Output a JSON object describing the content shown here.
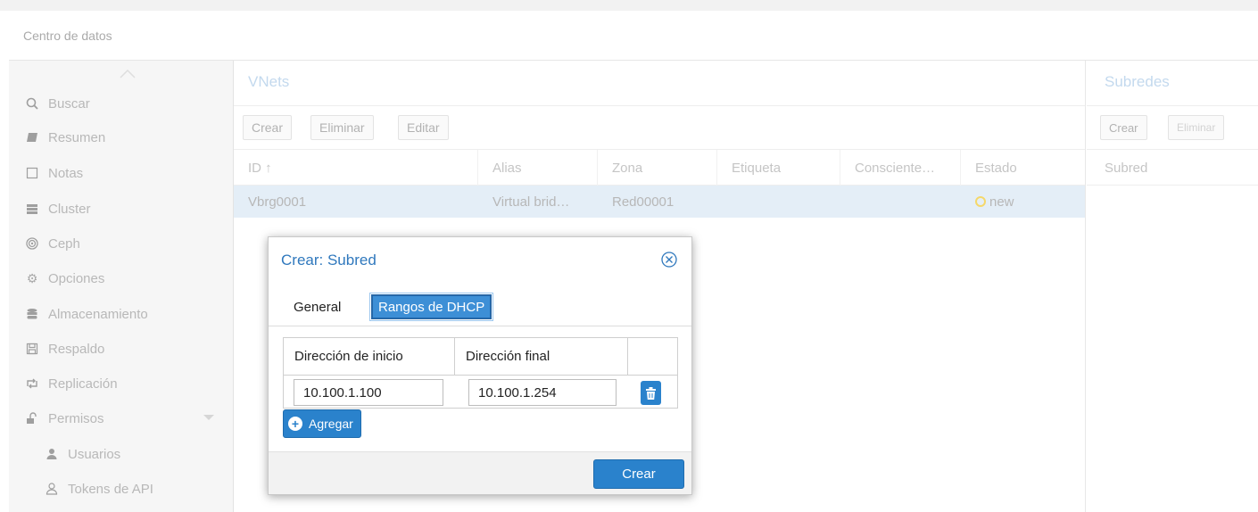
{
  "header": {
    "title": "Centro de datos"
  },
  "sidebar": {
    "items": [
      {
        "label": "Buscar",
        "icon": "search-icon"
      },
      {
        "label": "Resumen",
        "icon": "book-icon"
      },
      {
        "label": "Notas",
        "icon": "notes-icon"
      },
      {
        "label": "Cluster",
        "icon": "server-icon"
      },
      {
        "label": "Ceph",
        "icon": "ceph-icon"
      },
      {
        "label": "Opciones",
        "icon": "gear-icon"
      },
      {
        "label": "Almacenamiento",
        "icon": "database-icon"
      },
      {
        "label": "Respaldo",
        "icon": "floppy-icon"
      },
      {
        "label": "Replicación",
        "icon": "retweet-icon"
      },
      {
        "label": "Permisos",
        "icon": "unlock-icon"
      },
      {
        "label": "Usuarios",
        "icon": "user-icon"
      },
      {
        "label": "Tokens de API",
        "icon": "user-outline-icon"
      }
    ]
  },
  "vnets": {
    "title": "VNets",
    "toolbar": {
      "create": "Crear",
      "delete": "Eliminar",
      "edit": "Editar"
    },
    "columns": [
      "ID ↑",
      "Alias",
      "Zona",
      "Etiqueta",
      "Consciente…",
      "Estado"
    ],
    "rows": [
      {
        "id": "Vbrg0001",
        "alias": "Virtual brid…",
        "zone": "Red00001",
        "tag": "",
        "aware": "",
        "status": "new"
      }
    ]
  },
  "subnets": {
    "title": "Subredes",
    "toolbar": {
      "create": "Crear",
      "delete": "Eliminar"
    },
    "column": "Subred"
  },
  "dialog": {
    "title": "Crear: Subred",
    "tabs": [
      "General",
      "Rangos de DHCP"
    ],
    "active_tab": "Rangos de DHCP",
    "table": {
      "col_start": "Dirección de inicio",
      "col_end": "Dirección final",
      "rows": [
        {
          "start": "10.100.1.100",
          "end": "10.100.1.254"
        }
      ]
    },
    "add_label": "Agregar",
    "submit_label": "Crear"
  },
  "colors": {
    "accent": "#2a82cc",
    "title_blue": "#2f78bd",
    "selected_row": "#e4eef7",
    "status_new": "#f5d86a"
  }
}
